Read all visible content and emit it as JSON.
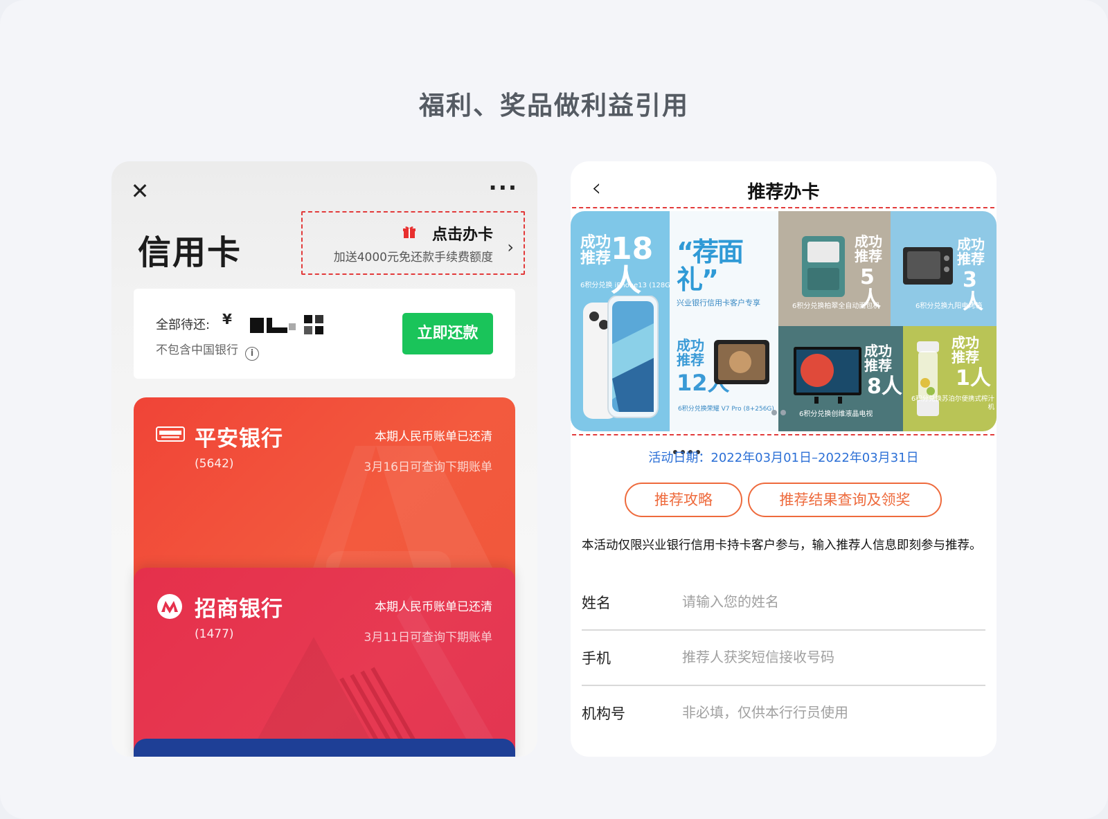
{
  "heading": "福利、奖品做利益引用",
  "left_phone": {
    "title": "信用卡",
    "close_icon": "close-icon",
    "more_icon": "more-icon",
    "promo": {
      "title": "点击办卡",
      "subtitle": "加送4000元免还款手续费额度",
      "icon": "gift-icon"
    },
    "repayment": {
      "label": "全部待还:",
      "currency": "¥",
      "note": "不包含中国银行",
      "button": "立即还款",
      "button_color": "#1ac45a"
    },
    "cards": [
      {
        "bank": "平安银行",
        "number": "(5642)",
        "status": "本期人民币账单已还清",
        "next": "3月16日可查询下期账单",
        "color": "#f04437"
      },
      {
        "bank": "招商银行",
        "number": "(1477)",
        "status": "本期人民币账单已还清",
        "next": "3月11日可查询下期账单",
        "color": "#e5304b"
      }
    ]
  },
  "right_phone": {
    "title": "推荐办卡",
    "back_icon": "chevron-left-icon",
    "banner": {
      "tiles": [
        {
          "line1": "成功",
          "line2": "推荐",
          "count": "18人",
          "prize": "6积分兑换 iPhone13 (128G)"
        },
        {
          "headline": "“荐面礼”",
          "sub": "兴业银行信用卡客户专享"
        },
        {
          "line1": "成功",
          "line2": "推荐",
          "count": "12人",
          "prize": "6积分兑换荣耀 V7 Pro (8+256G)"
        },
        {
          "line1": "成功",
          "line2": "推荐",
          "count": "5人",
          "prize": "6积分兑换柏翠全自动面包机"
        },
        {
          "line1": "成功",
          "line2": "推荐",
          "count": "3人",
          "prize": "6积分兑换九阳电烤箱"
        },
        {
          "line1": "成功",
          "line2": "推荐",
          "count": "8人",
          "prize": "6积分兑换创维液晶电视"
        },
        {
          "line1": "成功",
          "line2": "推荐",
          "count": "1人",
          "prize": "6积分兑换苏泊尔便携式榨汁机"
        }
      ]
    },
    "date": "活动日期：2022年03月01日–2022年03月31日",
    "buttons": {
      "guide": "推荐攻略",
      "results": "推荐结果查询及领奖"
    },
    "description": "本活动仅限兴业银行信用卡持卡客户参与，输入推荐人信息即刻参与推荐。",
    "form": [
      {
        "label": "姓名",
        "placeholder": "请输入您的姓名"
      },
      {
        "label": "手机",
        "placeholder": "推荐人获奖短信接收号码"
      },
      {
        "label": "机构号",
        "placeholder": "非必填，仅供本行行员使用"
      }
    ],
    "accent": "#ee6a3c",
    "date_color": "#2b6fd6"
  }
}
